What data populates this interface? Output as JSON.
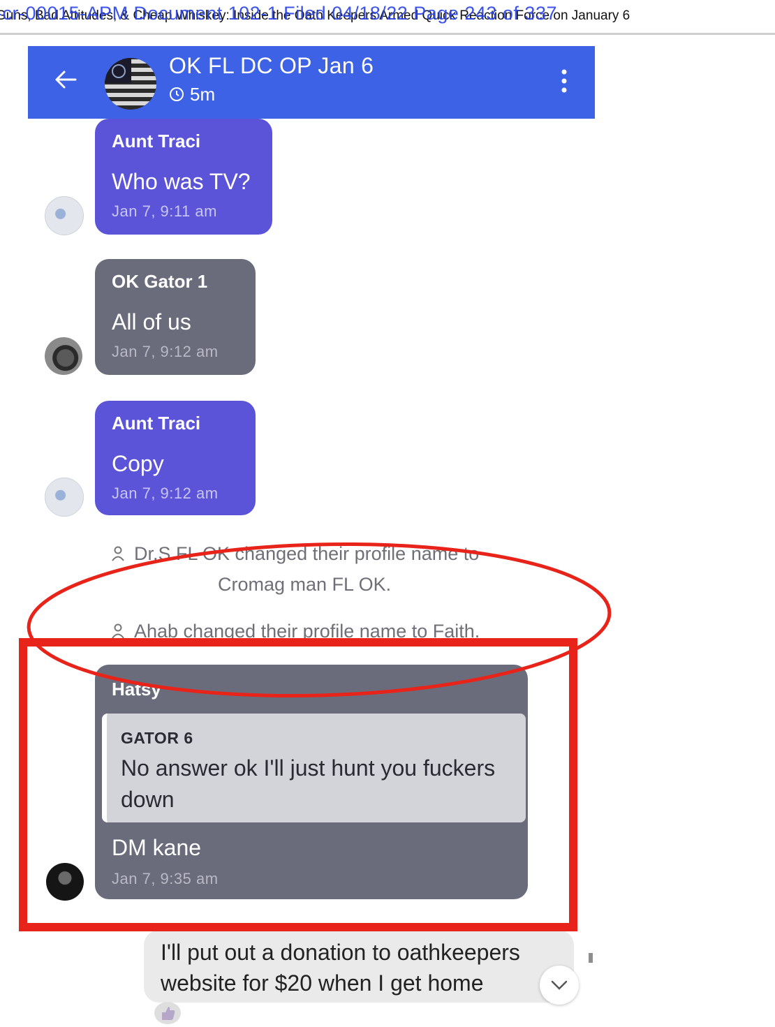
{
  "doc_header": {
    "underlay_text": "Guns, Bad Attitudes, & Cheap Whiskey: Inside the Oath Keepers Armed Quick Reaction Force on January 6",
    "overlay_text": "-cr-00015-APM   Document 102-1   Filed 04/18/22   Page 243 of 337"
  },
  "chat": {
    "title": "OK FL DC OP Jan 6",
    "timer": "5m"
  },
  "messages": [
    {
      "sender": "Aunt Traci",
      "text": "Who was TV?",
      "time": "Jan 7, 9:11 am"
    },
    {
      "sender": "OK Gator 1",
      "text": "All of us",
      "time": "Jan 7, 9:12 am"
    },
    {
      "sender": "Aunt Traci",
      "text": "Copy",
      "time": "Jan 7, 9:12 am"
    }
  ],
  "system_events": [
    {
      "line1": "Dr.S FL OK changed their profile name to",
      "line2": "Cromag man FL OK."
    },
    {
      "line1": "Ahab changed their profile name to Faith."
    }
  ],
  "reply_message": {
    "sender": "Hatsy",
    "quote_author": "GATOR 6",
    "quote_text": "No answer ok I'll just hunt you fuckers down",
    "text": "DM kane",
    "time": "Jan 7, 9:35 am"
  },
  "outgoing_message": {
    "text": "I'll put out a donation to oathkeepers website for $20 when I get home"
  },
  "colors": {
    "app_bar": "#3d62e6",
    "bubble_purple": "#5b54d9",
    "bubble_gray": "#6b6c7b",
    "annotation_red": "#e8231a"
  }
}
